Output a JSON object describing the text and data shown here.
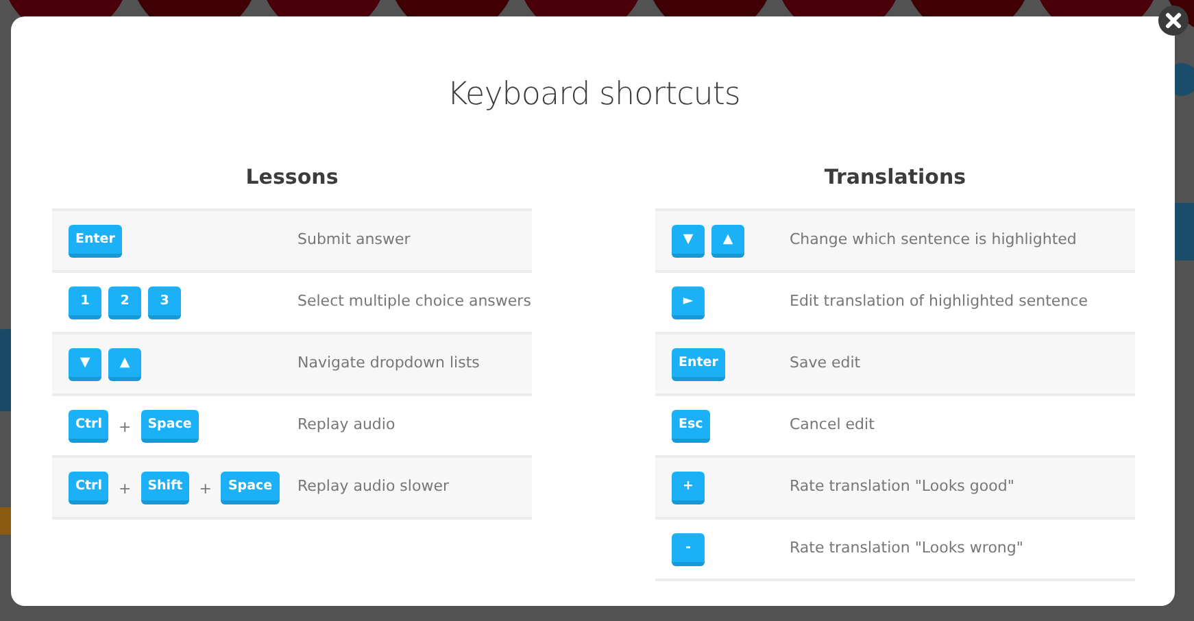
{
  "dialog": {
    "title": "Keyboard shortcuts",
    "sections": [
      {
        "heading": "Lessons",
        "shortcuts": [
          {
            "keys": [
              {
                "kind": "key",
                "label": "Enter"
              }
            ],
            "description": "Submit answer"
          },
          {
            "keys": [
              {
                "kind": "key",
                "label": "1"
              },
              {
                "kind": "key",
                "label": "2"
              },
              {
                "kind": "key",
                "label": "3"
              }
            ],
            "description": "Select multiple choice answers"
          },
          {
            "keys": [
              {
                "kind": "key",
                "label": "▼"
              },
              {
                "kind": "key",
                "label": "▲"
              }
            ],
            "description": "Navigate dropdown lists"
          },
          {
            "keys": [
              {
                "kind": "key",
                "label": "Ctrl"
              },
              {
                "kind": "plus",
                "label": "+"
              },
              {
                "kind": "key",
                "label": "Space"
              }
            ],
            "description": "Replay audio"
          },
          {
            "keys": [
              {
                "kind": "key",
                "label": "Ctrl"
              },
              {
                "kind": "plus",
                "label": "+"
              },
              {
                "kind": "key",
                "label": "Shift"
              },
              {
                "kind": "plus",
                "label": "+"
              },
              {
                "kind": "key",
                "label": "Space"
              }
            ],
            "description": "Replay audio slower"
          }
        ]
      },
      {
        "heading": "Translations",
        "shortcuts": [
          {
            "keys": [
              {
                "kind": "key",
                "label": "▼"
              },
              {
                "kind": "key",
                "label": "▲"
              }
            ],
            "description": "Change which sentence is highlighted"
          },
          {
            "keys": [
              {
                "kind": "key",
                "label": "►"
              }
            ],
            "description": "Edit translation of highlighted sentence"
          },
          {
            "keys": [
              {
                "kind": "key",
                "label": "Enter"
              }
            ],
            "description": "Save edit"
          },
          {
            "keys": [
              {
                "kind": "key",
                "label": "Esc"
              }
            ],
            "description": "Cancel edit"
          },
          {
            "keys": [
              {
                "kind": "key",
                "label": "+"
              }
            ],
            "description": "Rate translation \"Looks good\""
          },
          {
            "keys": [
              {
                "kind": "key",
                "label": "-"
              }
            ],
            "description": "Rate translation \"Looks wrong\""
          }
        ]
      }
    ]
  }
}
